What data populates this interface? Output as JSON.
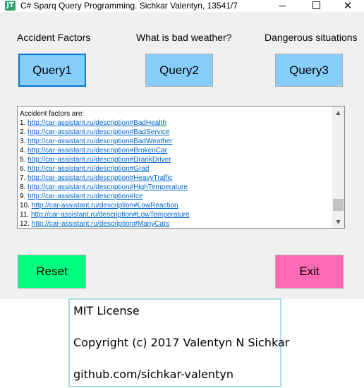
{
  "window": {
    "title": "C# Sparq Query Programming. Sichkar Valentyn, 13541/7",
    "icon": "app-icon",
    "icon_glyph": "JT",
    "close_glyph": "✕"
  },
  "labels": {
    "accident_factors": "Accident Factors",
    "bad_weather": "What is bad weather?",
    "dangerous_situations": "Dangerous situations"
  },
  "buttons": {
    "query1": "Query1",
    "query2": "Query2",
    "query3": "Query3",
    "reset": "Reset",
    "exit": "Exit"
  },
  "results": {
    "header": "Accident factors are:",
    "items": [
      {
        "num": "1.",
        "url": "http://car-assistant.ru/description#BadHealth"
      },
      {
        "num": "2.",
        "url": "http://car-assistant.ru/description#BadService"
      },
      {
        "num": "3.",
        "url": "http://car-assistant.ru/description#BadWeather"
      },
      {
        "num": "4.",
        "url": "http://car-assistant.ru/description#BrokenCar"
      },
      {
        "num": "5.",
        "url": "http://car-assistant.ru/description#DrankDriver"
      },
      {
        "num": "6.",
        "url": "http://car-assistant.ru/description#Grad"
      },
      {
        "num": "7.",
        "url": "http://car-assistant.ru/description#HeavyTraffic"
      },
      {
        "num": "8.",
        "url": "http://car-assistant.ru/description#HighTemperature"
      },
      {
        "num": "9.",
        "url": "http://car-assistant.ru/description#Ice"
      },
      {
        "num": "10.",
        "url": "http://car-assistant.ru/description#LowReaction"
      },
      {
        "num": "11.",
        "url": "http://car-assistant.ru/description#LowTemperature"
      },
      {
        "num": "12.",
        "url": "http://car-assistant.ru/description#ManyCars"
      }
    ],
    "scroll_up_glyph": "▲",
    "scroll_down_glyph": "▼"
  },
  "license": {
    "line1": "MIT License",
    "line2": "Copyright (c) 2017 Valentyn N Sichkar",
    "line3": "github.com/sichkar-valentyn"
  },
  "colors": {
    "query_button": "#87cefa",
    "reset_button": "#00ff80",
    "exit_button": "#ff69b4",
    "link": "#0066cc",
    "license_border": "#a8dce8"
  }
}
